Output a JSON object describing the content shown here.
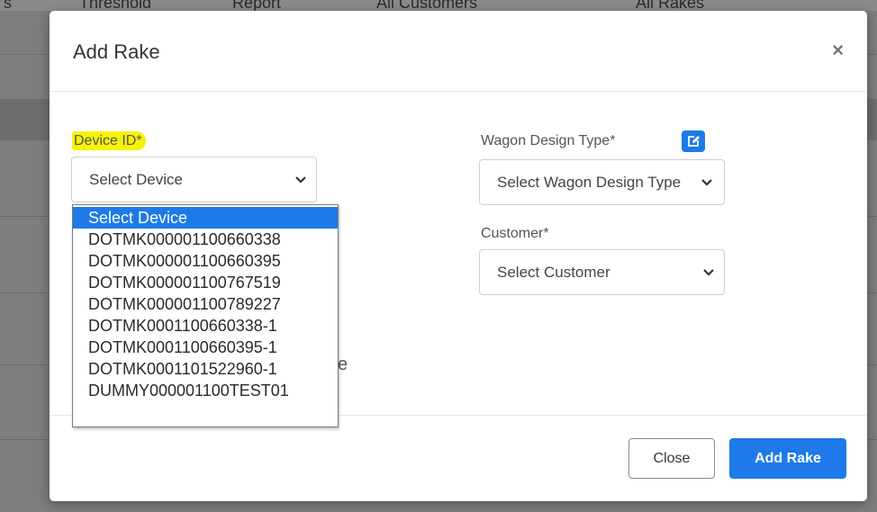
{
  "background": {
    "items": [
      "s",
      "Threshold",
      "Report",
      "All Customers",
      "All Rakes"
    ]
  },
  "modal": {
    "title": "Add Rake",
    "close_icon": "×",
    "device": {
      "label": "Device ID*",
      "value": "Select Device",
      "options": [
        "Select Device",
        "DOTMK000001100660338",
        "DOTMK000001100660395",
        "DOTMK000001100767519",
        "DOTMK000001100789227",
        "DOTMK0001100660338-1",
        "DOTMK0001100660395-1",
        "DOTMK0001101522960-1",
        "DUMMY000001100TEST01"
      ],
      "selected_index": 0
    },
    "wagon": {
      "label": "Wagon Design Type*",
      "value": "Select Wagon Design Type",
      "edit_icon": "edit-icon"
    },
    "customer": {
      "label": "Customer*",
      "value": "Select Customer"
    },
    "partial_text": "e",
    "footer": {
      "close_label": "Close",
      "add_label": "Add Rake"
    }
  },
  "colors": {
    "primary": "#1e7ae8",
    "highlight": "#f6f20a",
    "overlay": "#7d7d7d"
  }
}
